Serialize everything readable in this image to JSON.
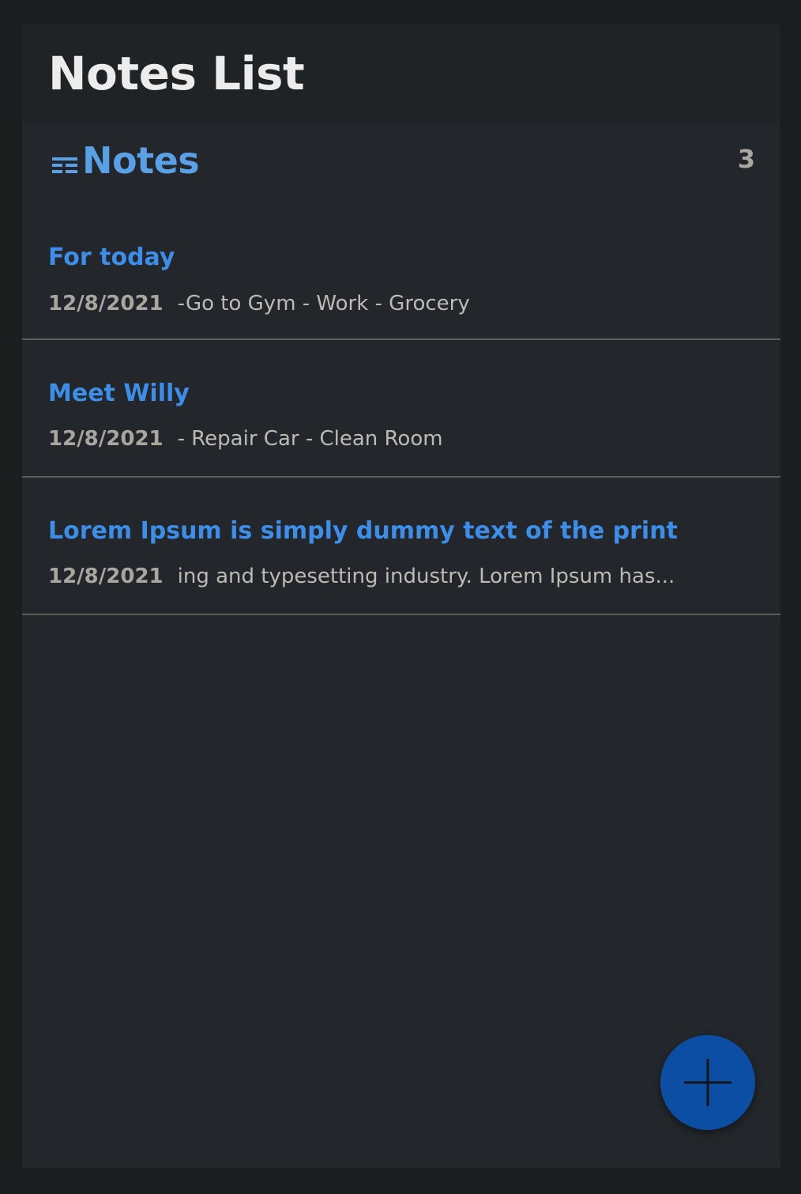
{
  "header": {
    "title": "Notes List"
  },
  "section": {
    "icon": "list-icon",
    "title": "Notes",
    "count": "3"
  },
  "notes": [
    {
      "title": "For today",
      "date": "12/8/2021",
      "preview": "-Go to Gym - Work - Grocery"
    },
    {
      "title": "Meet Willy",
      "date": "12/8/2021",
      "preview": "- Repair Car - Clean Room"
    },
    {
      "title": "Lorem Ipsum is simply dummy text of the print",
      "date": "12/8/2021",
      "preview": "ing and typesetting industry. Lorem Ipsum has..."
    }
  ],
  "fab": {
    "icon": "plus-icon"
  },
  "colors": {
    "page_background": "#1b1d1f",
    "panel_background": "#23272b",
    "header_background": "#202325",
    "accent": "#3c8ee8",
    "section_title": "#5aa0e6",
    "fab_background": "#0c4ea3",
    "divider": "#5e5c58"
  }
}
